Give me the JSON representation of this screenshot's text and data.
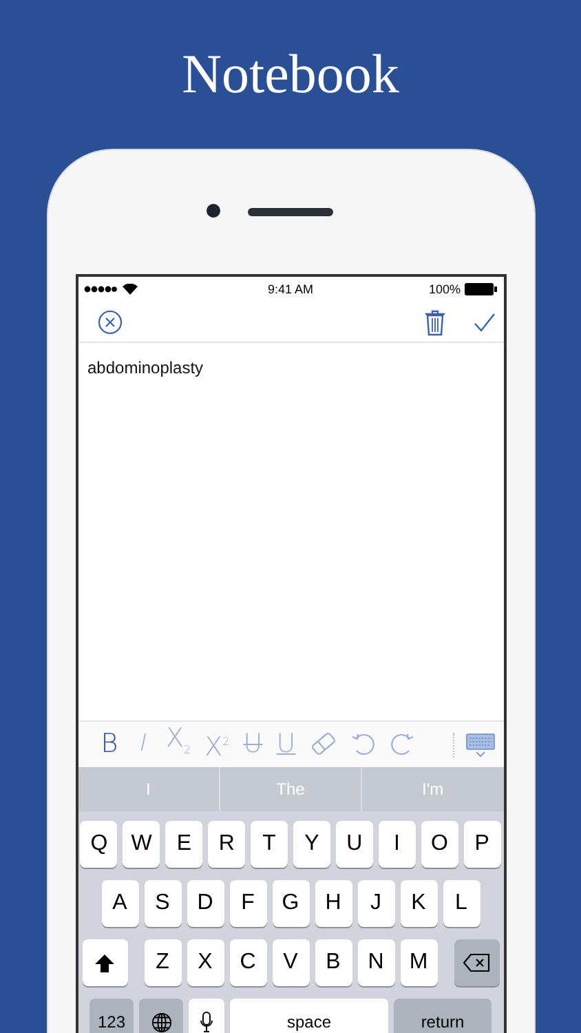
{
  "headline": "Notebook",
  "status_bar": {
    "time": "9:41 AM",
    "battery": "100%"
  },
  "note": {
    "text": "abdominoplasty"
  },
  "format_toolbar": [
    {
      "kind": "bold",
      "label": "B",
      "selected": true
    },
    {
      "kind": "italic",
      "label": "I",
      "selected": false
    },
    {
      "kind": "subscript",
      "label": "X$_{2}$",
      "selected": false
    },
    {
      "kind": "superscript",
      "label": "X$^{2}$",
      "selected": false
    },
    {
      "kind": "strike",
      "label": "U",
      "selected": false
    },
    {
      "kind": "underline",
      "label": "U",
      "selected": false
    },
    {
      "kind": "eraser",
      "selected": false
    },
    {
      "kind": "undo",
      "selected": false
    },
    {
      "kind": "redo",
      "selected": false
    }
  ],
  "suggestions": [
    "I",
    "The",
    "I'm"
  ],
  "keyboard": {
    "rows": [
      [
        "Q",
        "W",
        "E",
        "R",
        "T",
        "Y",
        "U",
        "I",
        "O",
        "P"
      ],
      [
        "A",
        "S",
        "D",
        "F",
        "G",
        "H",
        "J",
        "K",
        "L"
      ],
      [
        "Z",
        "X",
        "C",
        "V",
        "B",
        "N",
        "M"
      ]
    ],
    "numbers_key": "123",
    "space_key": "space",
    "return_key": "return"
  }
}
